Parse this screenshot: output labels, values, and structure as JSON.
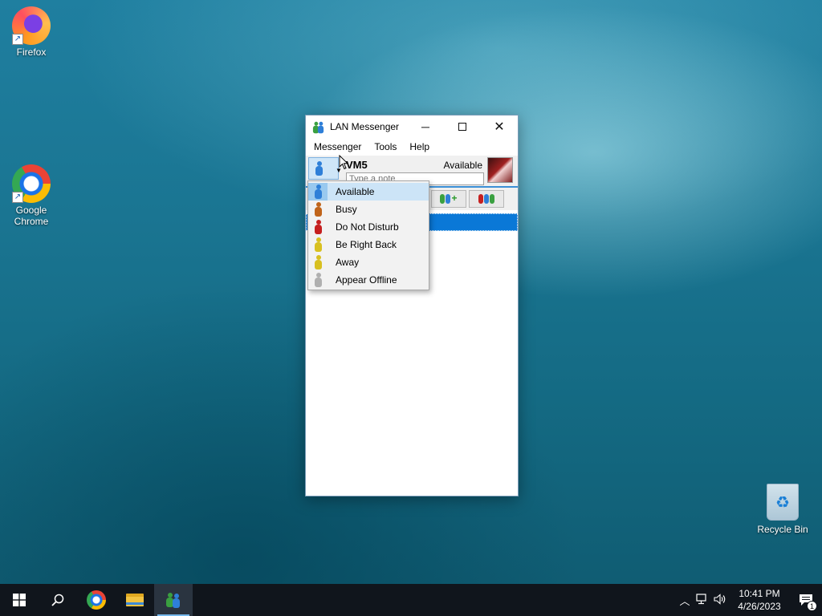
{
  "desktop": {
    "icons": [
      {
        "label": "Firefox"
      },
      {
        "label": "Google Chrome"
      },
      {
        "label": "Recycle Bin"
      }
    ]
  },
  "window": {
    "title": "LAN Messenger",
    "menu": [
      "Messenger",
      "Tools",
      "Help"
    ],
    "user": {
      "name": "VM5",
      "status": "Available",
      "note_placeholder": "Type a note"
    }
  },
  "status_menu": {
    "items": [
      {
        "label": "Available",
        "color": "#2e7fd8",
        "active": true
      },
      {
        "label": "Busy",
        "color": "#c0641a"
      },
      {
        "label": "Do Not Disturb",
        "color": "#c62020"
      },
      {
        "label": "Be Right Back",
        "color": "#d8c020"
      },
      {
        "label": "Away",
        "color": "#d8c020"
      },
      {
        "label": "Appear Offline",
        "color": "#b0b0b0"
      }
    ]
  },
  "taskbar": {
    "time": "10:41 PM",
    "date": "4/26/2023",
    "notification_count": "1"
  },
  "colors": {
    "accent": "#0a78d7",
    "taskbar": "#10151c"
  }
}
